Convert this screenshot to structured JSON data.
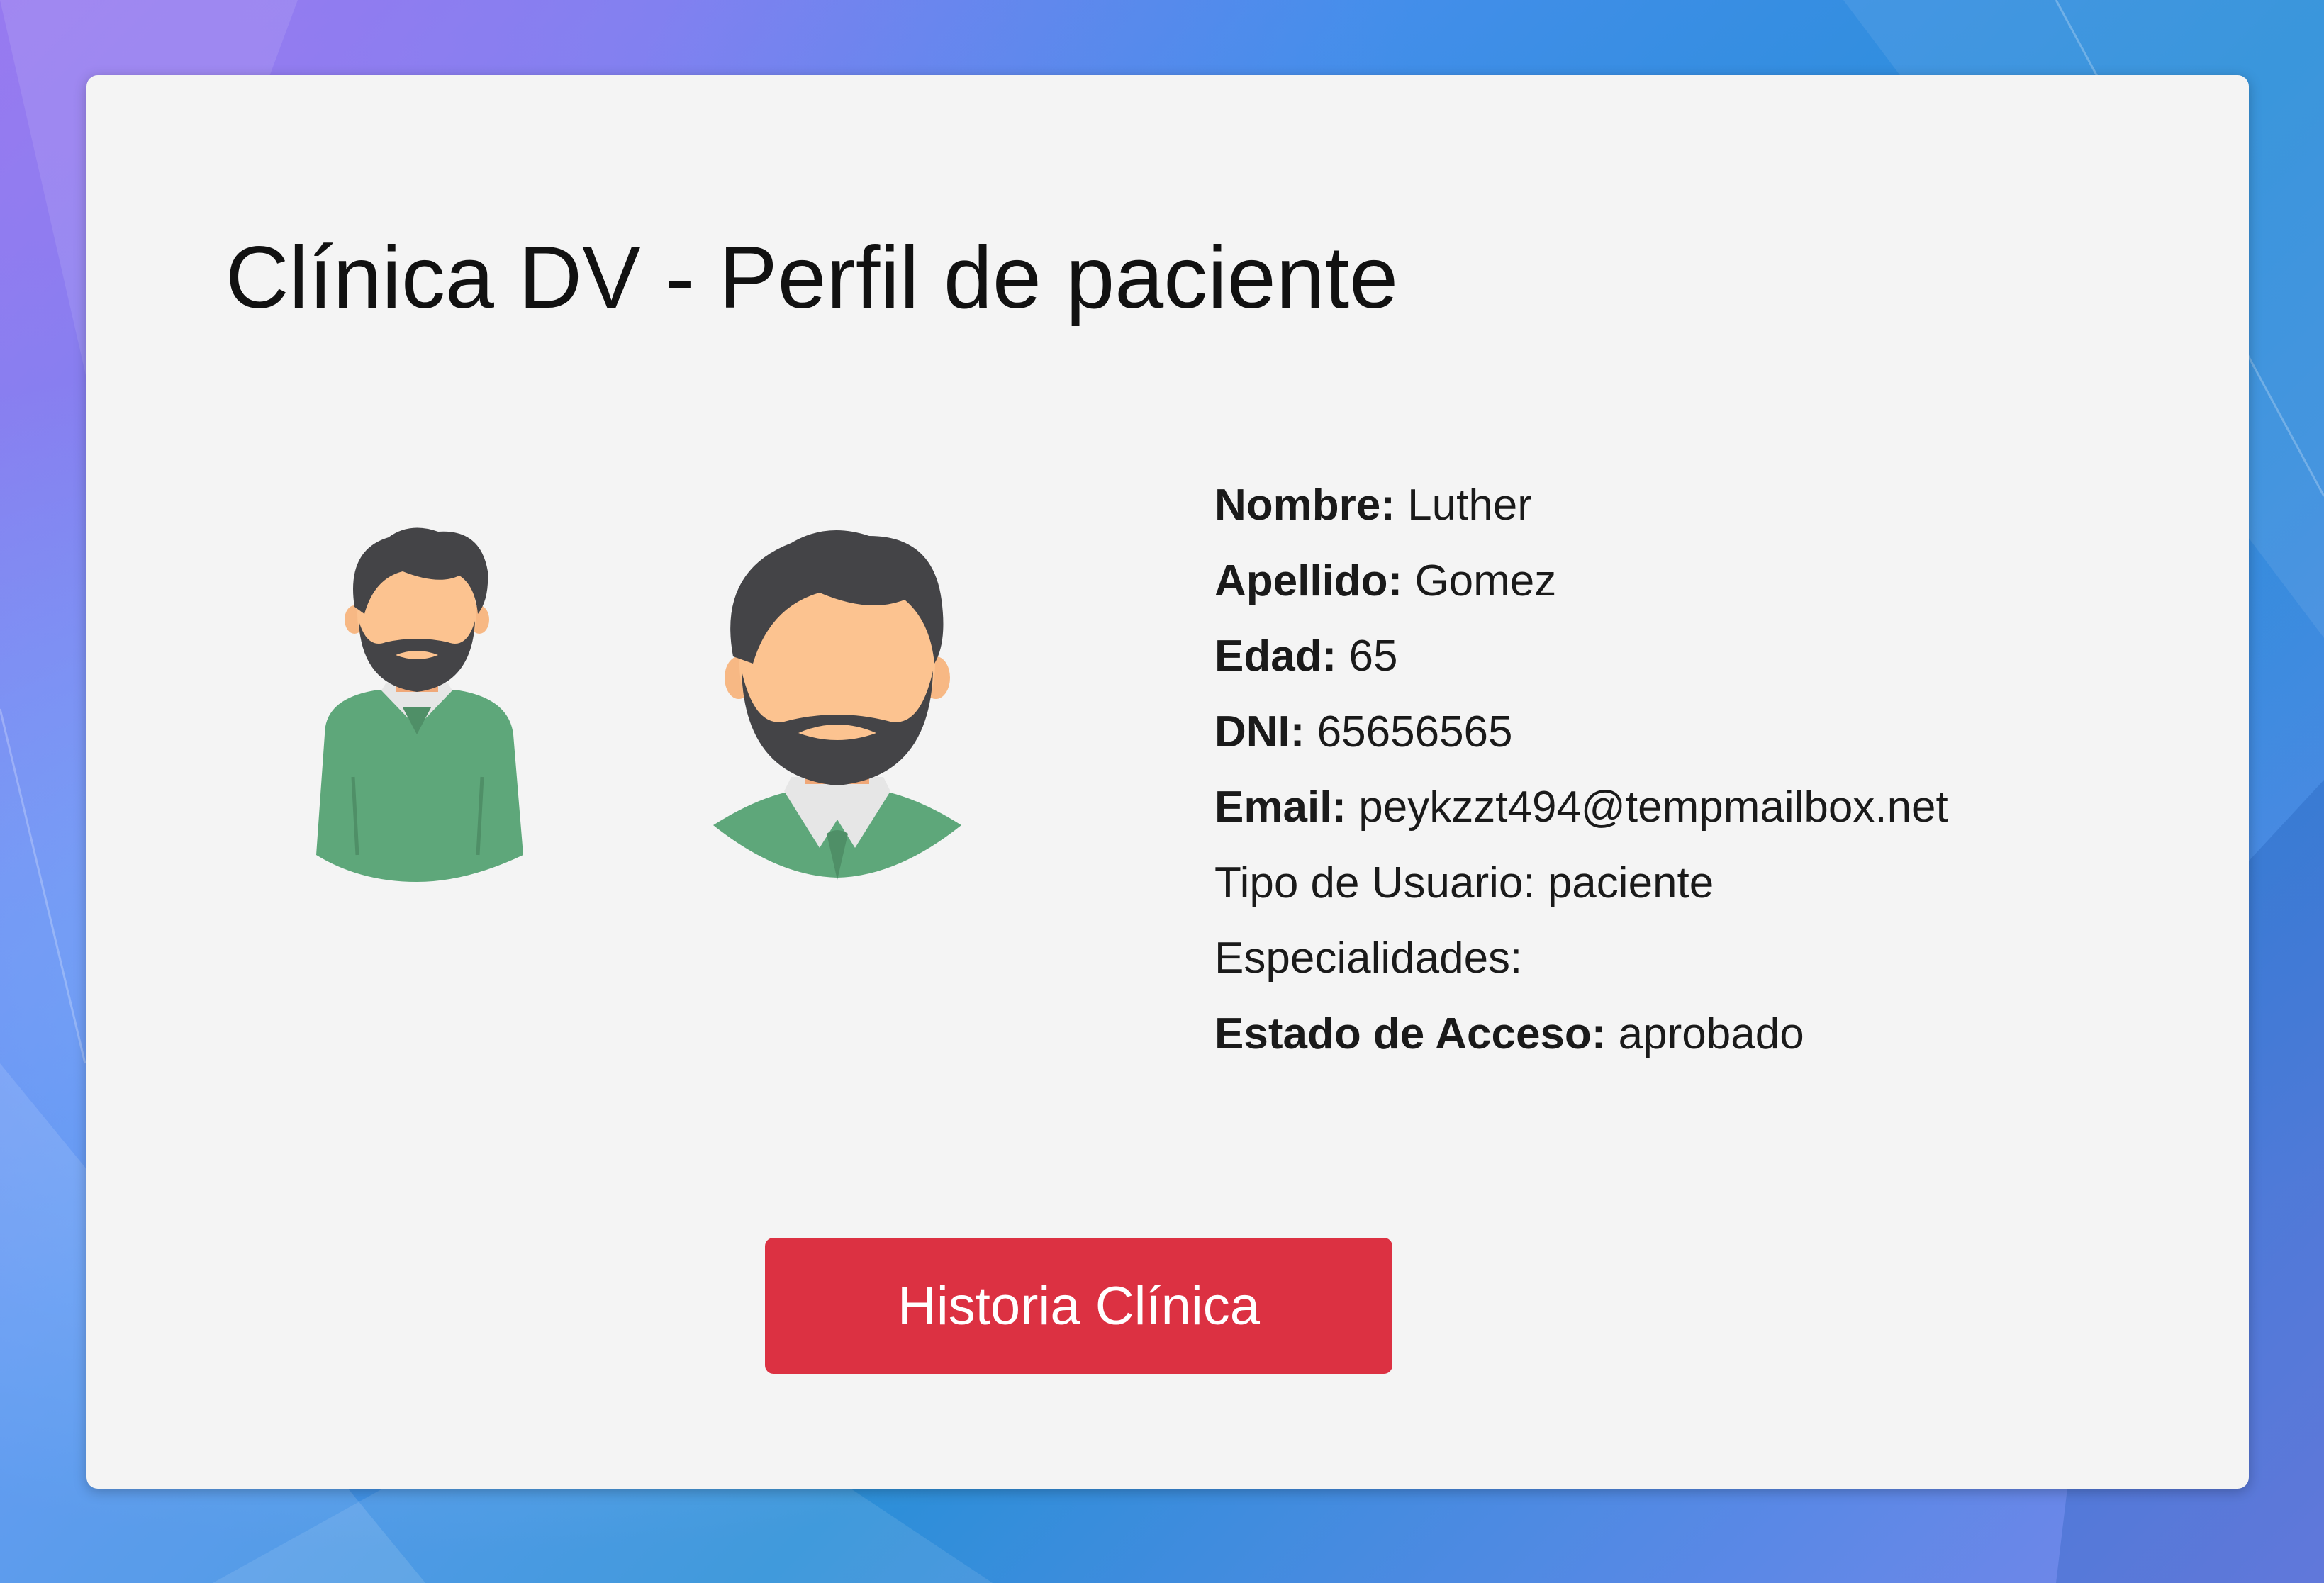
{
  "page": {
    "title": "Clínica DV - Perfil de paciente"
  },
  "patient": {
    "nombre": {
      "label": "Nombre:",
      "value": "Luther"
    },
    "apellido": {
      "label": "Apellido:",
      "value": "Gomez"
    },
    "edad": {
      "label": "Edad:",
      "value": "65"
    },
    "dni": {
      "label": "DNI:",
      "value": "65656565"
    },
    "email": {
      "label": "Email:",
      "value": "peykzzt494@tempmailbox.net"
    },
    "tipo_usuario": {
      "label": "Tipo de Usuario:",
      "value": "paciente"
    },
    "especialidades": {
      "label": "Especialidades:",
      "value": ""
    },
    "estado_acceso": {
      "label": "Estado de Acceso:",
      "value": "aprobado"
    }
  },
  "actions": {
    "historia_clinica_label": "Historia Clínica"
  },
  "avatars": {
    "small_icon": "user-avatar-half-body",
    "large_icon": "user-avatar-head"
  },
  "colors": {
    "button": "#dc3142",
    "card_bg": "#f4f4f4",
    "sweater": "#5ea77a",
    "skin": "#fcc390",
    "hair": "#444447"
  }
}
